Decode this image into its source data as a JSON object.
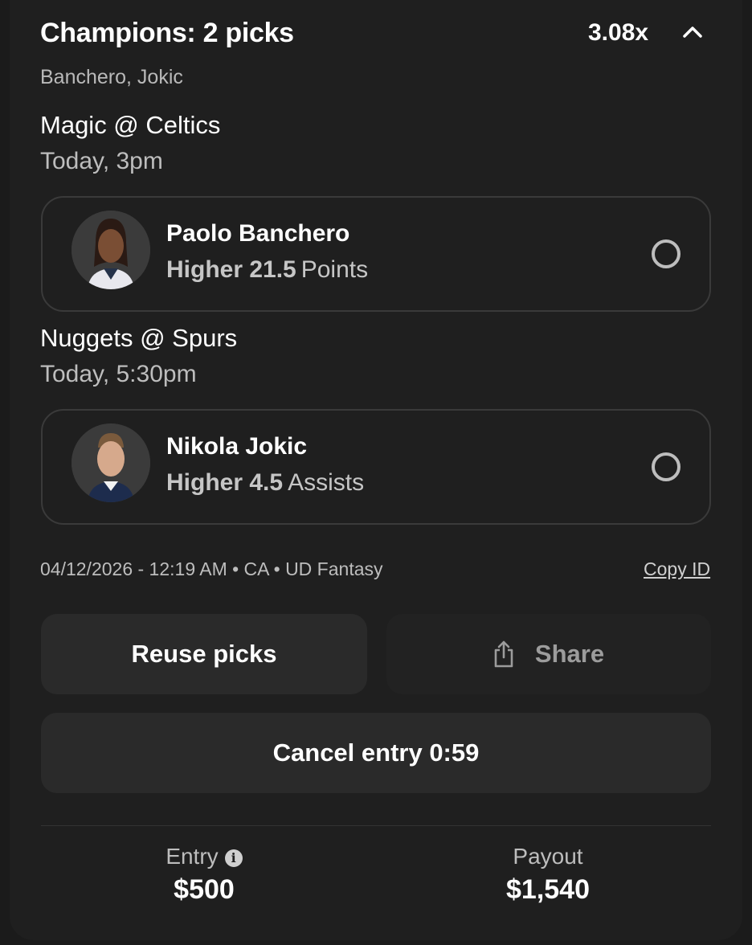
{
  "entry_card": {
    "title": "Champions: 2 picks",
    "multiplier": "3.08x",
    "players_summary": "Banchero, Jokic"
  },
  "games": [
    {
      "matchup": "Magic @ Celtics",
      "time": "Today, 3pm",
      "pick": {
        "player": "Paolo Banchero",
        "direction": "Higher 21.5",
        "stat": "Points",
        "avatar": "player-headshot",
        "status": "pending"
      }
    },
    {
      "matchup": "Nuggets @ Spurs",
      "time": "Today, 5:30pm",
      "pick": {
        "player": "Nikola Jokic",
        "direction": "Higher 4.5",
        "stat": "Assists",
        "avatar": "player-headshot",
        "status": "pending"
      }
    }
  ],
  "meta": {
    "info": "04/12/2026 - 12:19 AM • CA • UD Fantasy",
    "copy_id_label": "Copy ID"
  },
  "actions": {
    "reuse_label": "Reuse picks",
    "share_label": "Share",
    "cancel_label": "Cancel entry 0:59"
  },
  "footer": {
    "entry_label": "Entry",
    "entry_value": "$500",
    "payout_label": "Payout",
    "payout_value": "$1,540"
  },
  "icons": {
    "collapse": "chevron-up-icon",
    "share": "share-icon",
    "info": "info-icon",
    "status": "empty-circle-icon"
  },
  "colors": {
    "background": "#1b1b1b",
    "card": "#1f1f1f",
    "button": "#2a2a2a",
    "text_primary": "#ffffff",
    "text_secondary": "#bdbdbd"
  }
}
